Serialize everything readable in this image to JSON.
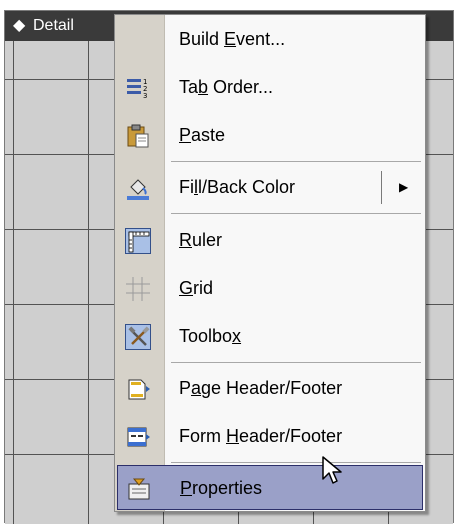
{
  "section": {
    "arrow": "◆",
    "title": "Detail"
  },
  "menu": {
    "items": [
      {
        "id": "build-event",
        "pre": "Build ",
        "key": "E",
        "post": "vent...",
        "icon": "none"
      },
      {
        "id": "tab-order",
        "pre": "Ta",
        "key": "b",
        "post": " Order...",
        "icon": "tab-order-icon"
      },
      {
        "id": "paste",
        "pre": "",
        "key": "P",
        "post": "aste",
        "icon": "clipboard-icon"
      },
      {
        "id": "fill-back-color",
        "pre": "Fi",
        "key": "l",
        "post": "l/Back Color",
        "icon": "paint-bucket-icon",
        "submenu_arrow": "▶"
      },
      {
        "id": "ruler",
        "pre": "",
        "key": "R",
        "post": "uler",
        "icon": "ruler-icon"
      },
      {
        "id": "grid",
        "pre": "",
        "key": "G",
        "post": "rid",
        "icon": "grid-icon"
      },
      {
        "id": "toolbox",
        "pre": "Toolbo",
        "key": "x",
        "post": "",
        "icon": "toolbox-icon"
      },
      {
        "id": "page-header-footer",
        "pre": "P",
        "key": "a",
        "post": "ge Header/Footer",
        "icon": "page-header-icon"
      },
      {
        "id": "form-header-footer",
        "pre": "Form ",
        "key": "H",
        "post": "eader/Footer",
        "icon": "form-header-icon"
      },
      {
        "id": "properties",
        "pre": "",
        "key": "P",
        "post": "roperties",
        "icon": "properties-icon",
        "highlighted": true
      }
    ]
  },
  "colors": {
    "highlight": "#9aa0c8",
    "gutter": "#d6d2c9",
    "detail_bar": "#3a3a3a"
  }
}
